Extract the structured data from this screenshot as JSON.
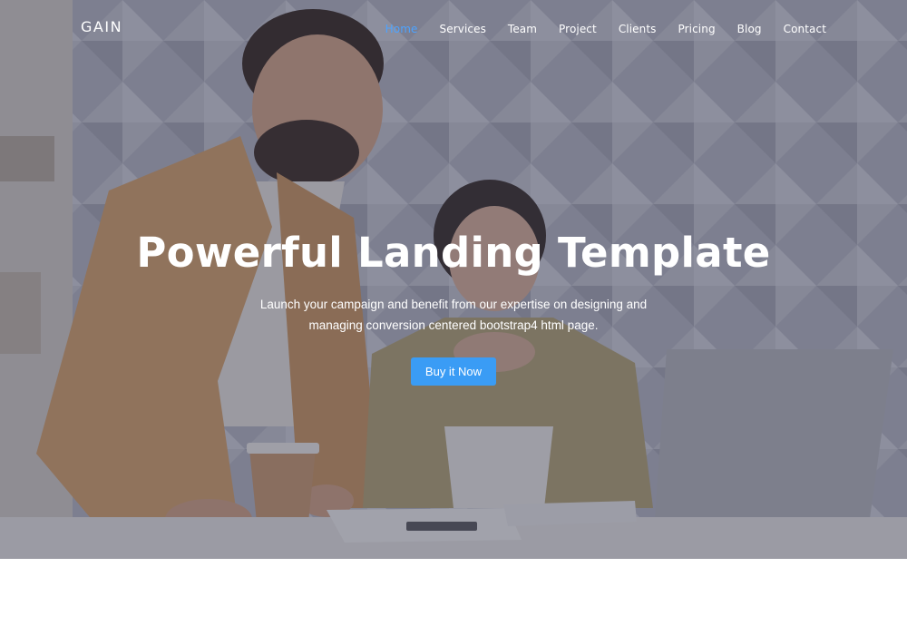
{
  "nav": {
    "brand": "GAIN",
    "links": [
      {
        "label": "Home",
        "active": true
      },
      {
        "label": "Services",
        "active": false
      },
      {
        "label": "Team",
        "active": false
      },
      {
        "label": "Project",
        "active": false
      },
      {
        "label": "Clients",
        "active": false
      },
      {
        "label": "Pricing",
        "active": false
      },
      {
        "label": "Blog",
        "active": false
      },
      {
        "label": "Contact",
        "active": false
      }
    ]
  },
  "hero": {
    "title": "Powerful Landing Template",
    "subtitle": "Launch your campaign and benefit from our expertise on designing and managing conversion centered bootstrap4 html page.",
    "cta_label": "Buy it Now"
  },
  "colors": {
    "accent": "#3a9cf5",
    "active_nav": "#4da3ff",
    "overlay": "#2c2e46"
  }
}
